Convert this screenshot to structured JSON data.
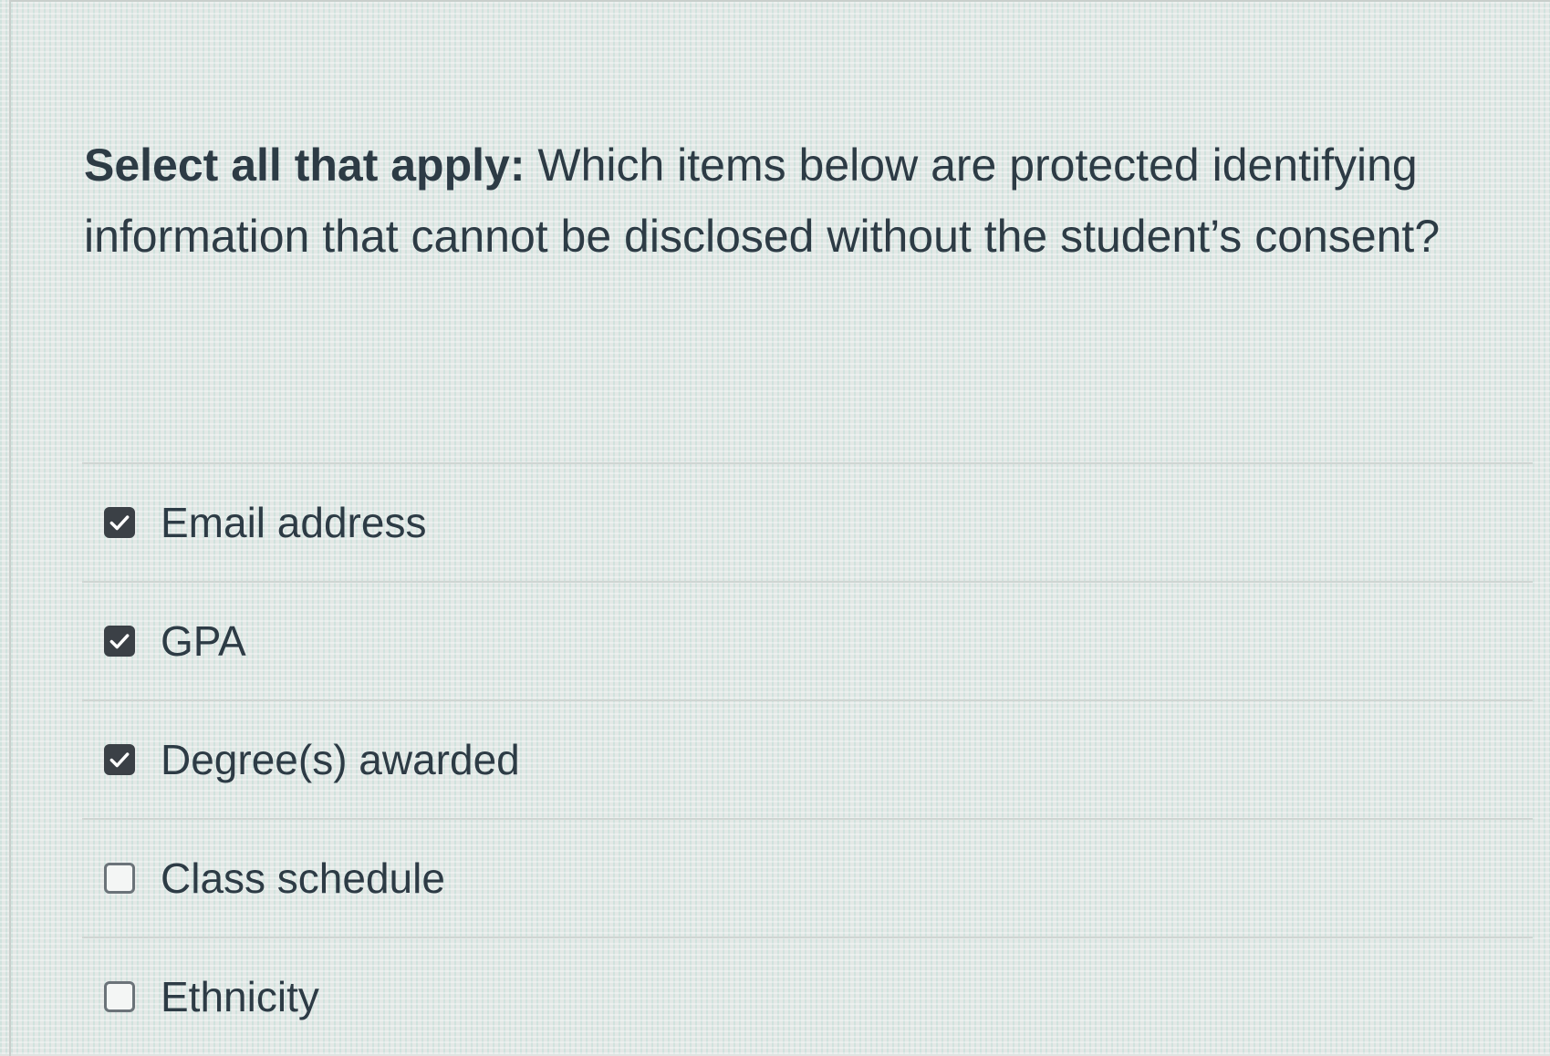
{
  "question": {
    "lead": "Select all that apply:",
    "body": " Which items below are protected identifying information that cannot be disclosed without the student’s consent?"
  },
  "answers": [
    {
      "label": "Email address",
      "checked": true
    },
    {
      "label": "GPA",
      "checked": true
    },
    {
      "label": "Degree(s) awarded",
      "checked": true
    },
    {
      "label": "Class schedule",
      "checked": false
    },
    {
      "label": "Ethnicity",
      "checked": false
    }
  ],
  "colors": {
    "text": "#2d3b45",
    "checkbox_checked": "#3b4046",
    "checkbox_border": "#6b7379"
  },
  "icons": {
    "checked": "checkmark-icon"
  }
}
